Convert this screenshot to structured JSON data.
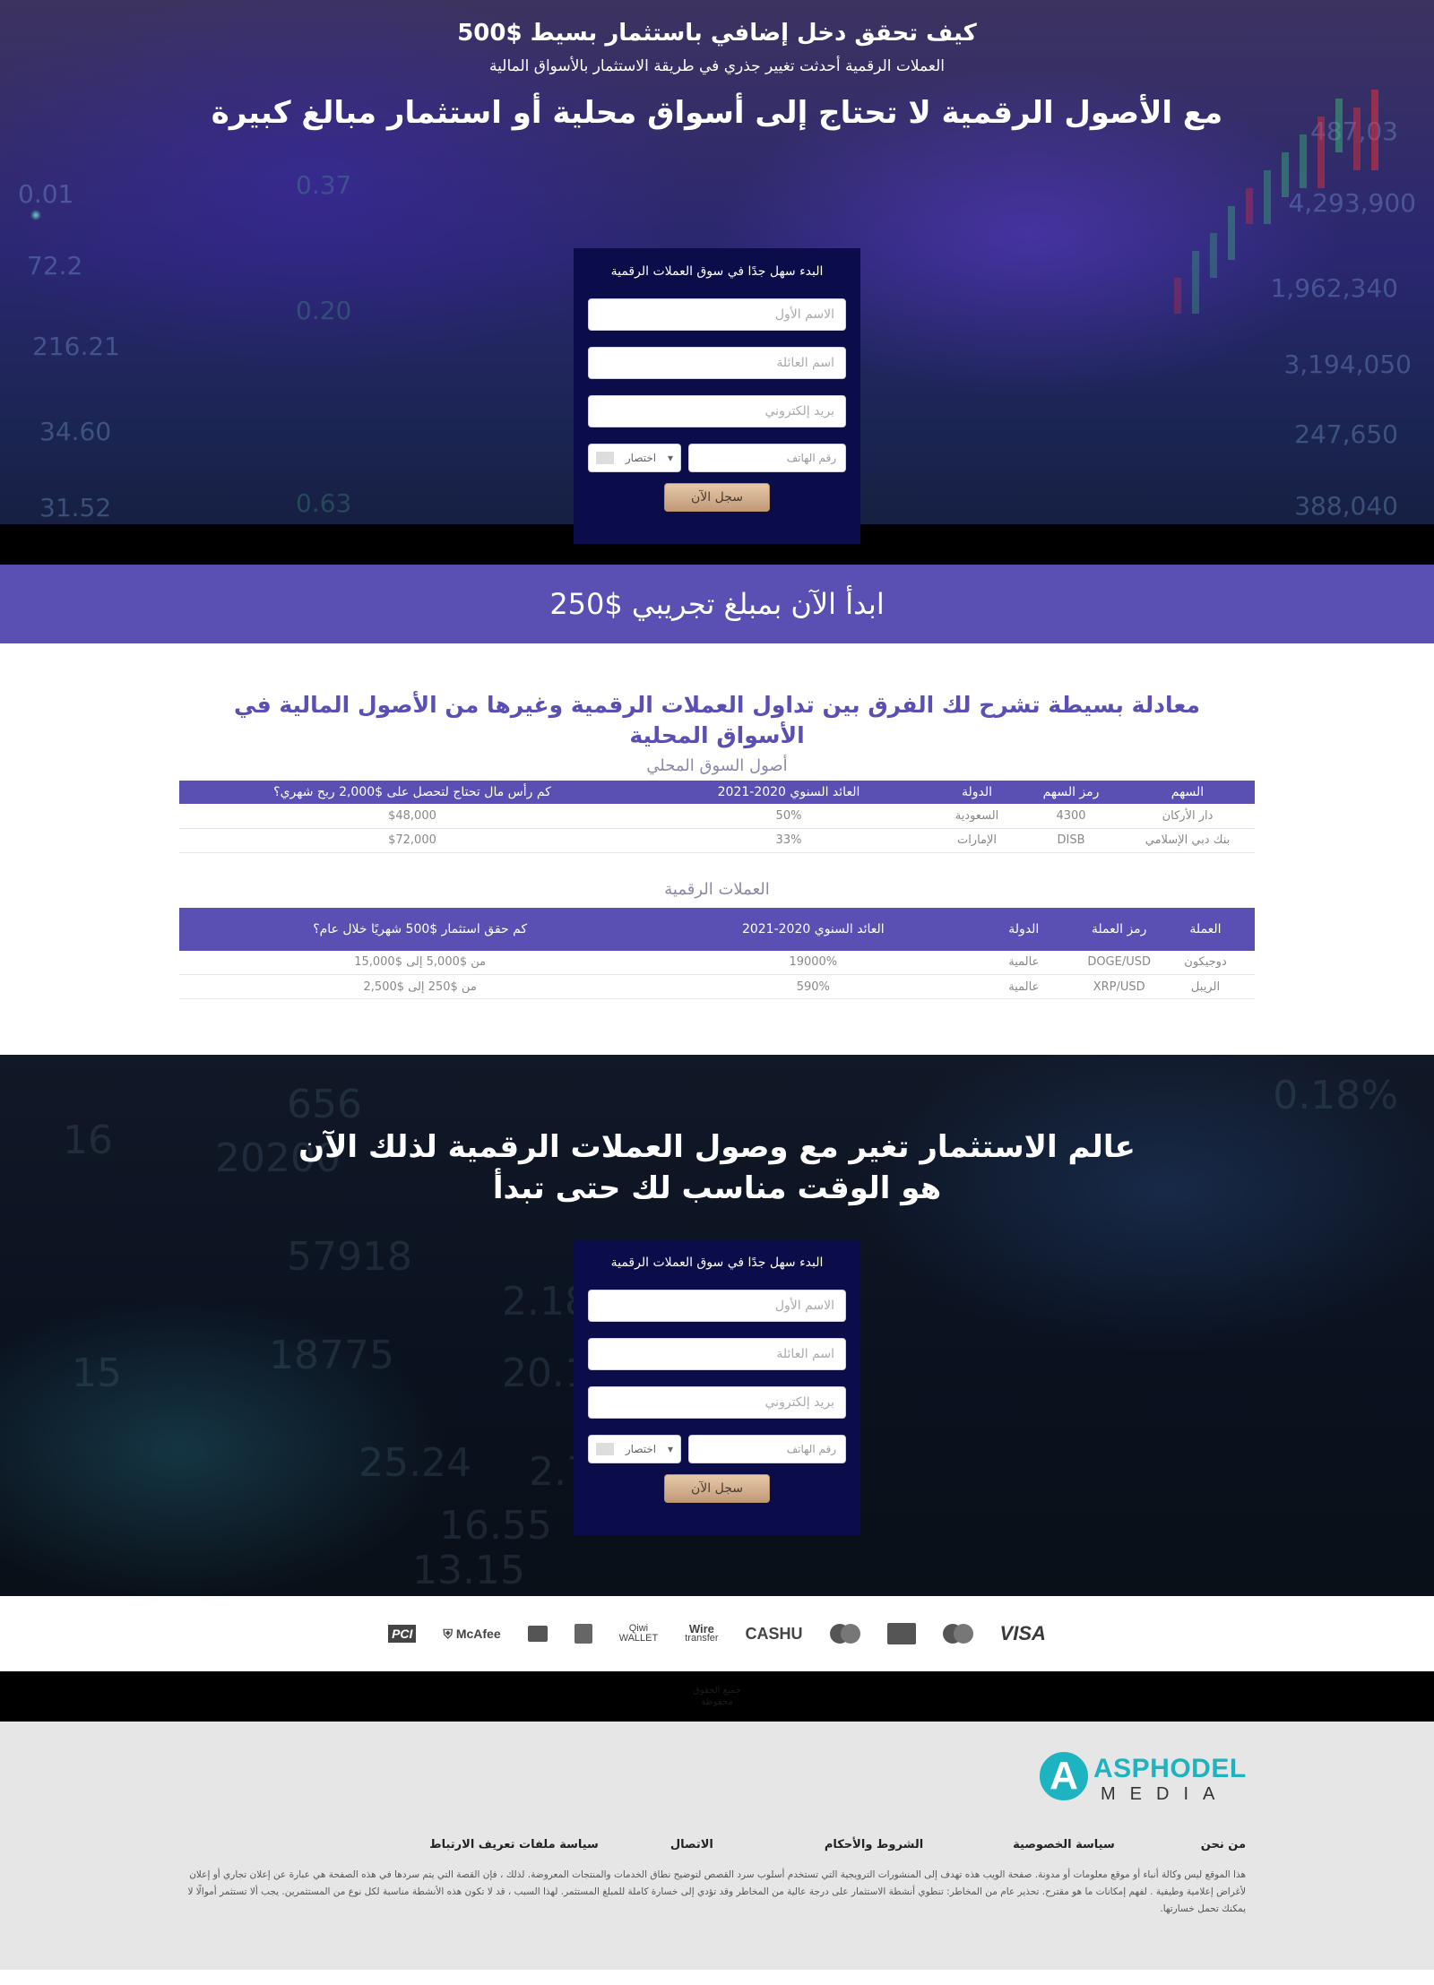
{
  "hero": {
    "heading_small": "كيف تحقق دخل إضافي باستثمار بسيط $500",
    "subheading": "العملات الرقمية أحدثت تغيير جذري في طريقة الاستثمار بالأسواق المالية",
    "heading_large": "مع الأصول الرقمية لا تحتاج إلى أسواق محلية أو استثمار مبالغ كبيرة",
    "bg_numbers_right": [
      "487,03",
      "4,293,900",
      "1,962,340",
      "3,194,050",
      "247,650",
      "388,040"
    ],
    "bg_numbers_left": [
      "0.01",
      "72.2",
      "216.21",
      "34.60",
      "31.52"
    ],
    "bg_numbers_mid": [
      "0.37",
      "0.20",
      "0.63"
    ]
  },
  "form": {
    "title": "البدء سهل جدًا في سوق العملات الرقمية",
    "first_name_placeholder": "الاسم الأول",
    "last_name_placeholder": "اسم العائلة",
    "email_placeholder": "بريد إلكتروني",
    "phone_placeholder": "رقم الهاتف",
    "country_select": "اختصار",
    "submit_label": "سجل الآن"
  },
  "band": {
    "text": "ابدأ الآن بمبلغ تجريبي $250"
  },
  "comparison": {
    "title": "معادلة بسيطة تشرح لك الفرق بين تداول العملات الرقمية وغيرها من الأصول المالية في الأسواق المحلية",
    "local_caption": "أصول السوق المحلي",
    "local_headers": [
      "السهم",
      "رمز السهم",
      "الدولة",
      "العائد السنوي 2020-2021",
      "كم رأس مال تحتاج لتحصل على $2,000 ربح شهري؟"
    ],
    "local_rows": [
      [
        "دار الأركان",
        "4300",
        "السعودية",
        "50%",
        "$48,000"
      ],
      [
        "بنك دبي الإسلامي",
        "DISB",
        "الإمارات",
        "33%",
        "$72,000"
      ]
    ],
    "crypto_caption": "العملات الرقمية",
    "crypto_headers": [
      "العملة",
      "رمز العملة",
      "الدولة",
      "العائد السنوي 2020-2021",
      "كم حقق استثمار $500 شهريًا خلال عام؟"
    ],
    "crypto_rows": [
      [
        "دوجيكون",
        "DOGE/USD",
        "عالمية",
        "19000%",
        "من $5,000 إلى $15,000"
      ],
      [
        "الريبل",
        "XRP/USD",
        "عالمية",
        "590%",
        "من $250 إلى $2,500"
      ]
    ]
  },
  "hero2": {
    "heading": "عالم الاستثمار تغير مع وصول العملات الرقمية لذلك الآن هو الوقت مناسب لك حتى تبدأ",
    "bg_numbers": [
      "16",
      "20200",
      "57918",
      "18775",
      "15",
      "2.7",
      "2.18",
      "20.15",
      "25.24",
      "16.55",
      "13.15",
      "0.18%",
      "656"
    ]
  },
  "payments": {
    "items": [
      "VISA",
      "Visa Electron",
      "MasterCard",
      "Maestro",
      "CASHU",
      "Wire transfer",
      "Qiwi WALLET",
      "Verified",
      "Amex",
      "McAfee",
      "PCI"
    ],
    "wire_line1": "Wire",
    "wire_line2": "transfer",
    "qiwi_line1": "Qiwi",
    "qiwi_line2": "WALLET",
    "mcafee_text": "McAfee",
    "pci_text": "PCI",
    "visa_text": "VISA",
    "cashu_text": "CASHU"
  },
  "strip": {
    "text": "جميع الحقوق محفوظة"
  },
  "footer": {
    "logo_line1": "ASPHODEL",
    "logo_line2": "MEDIA",
    "logo_letter": "A",
    "nav": [
      "من نحن",
      "سياسة الخصوصية",
      "الشروط والأحكام",
      "الاتصال",
      "سياسة ملفات تعريف الارتباط"
    ],
    "disclaimer": "هذا الموقع ليس وكالة أنباء أو موقع معلومات أو مدونة. صفحة الويب هذه تهدف إلى المنشورات الترويجية التي تستخدم أسلوب سرد القصص لتوضيح نطاق الخدمات والمنتجات المعروضة. لذلك ، فإن القصة التي يتم سردها في هذه الصفحة هي عبارة عن إعلان تجاري أو إعلان لأغراض إعلامية وطيفية . لفهم إمكانات ما هو مقترح. تحذير عام من المخاطر: تنطوي أنشطة الاستثمار على درجة عالية من المخاطر وقد تؤدي إلى خسارة كاملة للمبلغ المستثمر. لهذا السبب ، قد لا تكون هذه الأنشطة مناسبة لكل نوع من المستثمرين. يجب ألا تستثمر أموالًا لا يمكنك تحمل خسارتها."
  }
}
